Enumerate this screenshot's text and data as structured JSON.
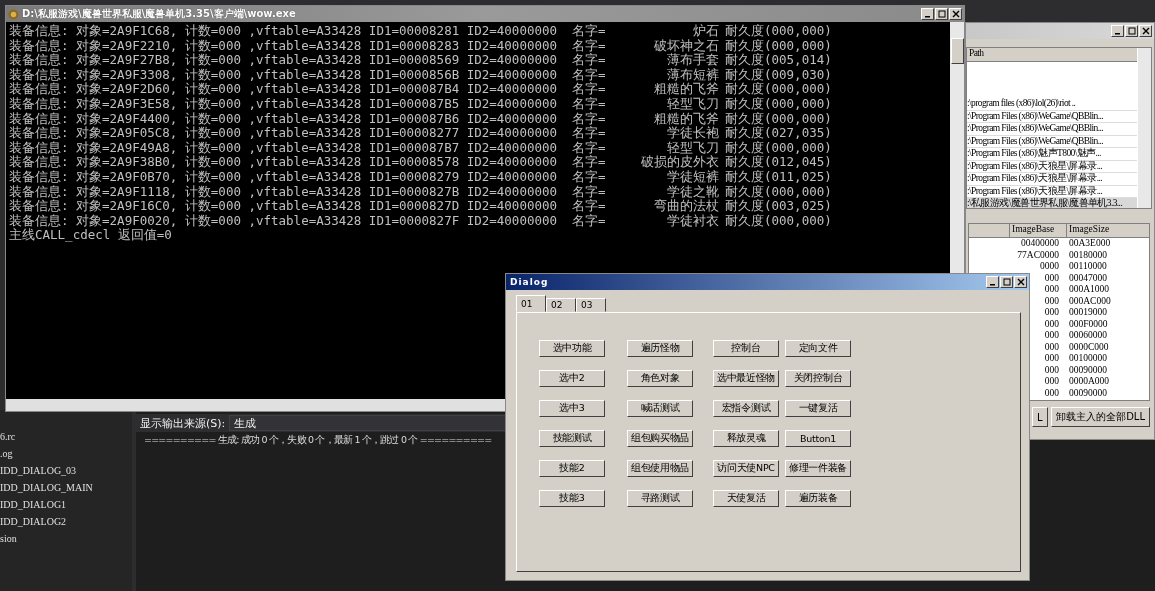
{
  "console": {
    "title": "D:\\私服游戏\\魔兽世界私服\\魔兽单机3.35\\客户端\\wow.exe",
    "lines": [
      {
        "text": "装备信息: 对象=2A9F1C68, 计数=000 ,vftable=A33428 ID1=00008281 ID2=40000000  名字=",
        "name": "炉石",
        "durability": "耐久度(000,000)"
      },
      {
        "text": "装备信息: 对象=2A9F2210, 计数=000 ,vftable=A33428 ID1=00008283 ID2=40000000  名字=",
        "name": "破坏神之石",
        "durability": "耐久度(000,000)"
      },
      {
        "text": "装备信息: 对象=2A9F27B8, 计数=000 ,vftable=A33428 ID1=00008569 ID2=40000000  名字=",
        "name": "薄布手套",
        "durability": "耐久度(005,014)"
      },
      {
        "text": "装备信息: 对象=2A9F3308, 计数=000 ,vftable=A33428 ID1=0000856B ID2=40000000  名字=",
        "name": "薄布短裤",
        "durability": "耐久度(009,030)"
      },
      {
        "text": "装备信息: 对象=2A9F2D60, 计数=000 ,vftable=A33428 ID1=000087B4 ID2=40000000  名字=",
        "name": "粗糙的飞斧",
        "durability": "耐久度(000,000)"
      },
      {
        "text": "装备信息: 对象=2A9F3E58, 计数=000 ,vftable=A33428 ID1=000087B5 ID2=40000000  名字=",
        "name": "轻型飞刀",
        "durability": "耐久度(000,000)"
      },
      {
        "text": "装备信息: 对象=2A9F4400, 计数=000 ,vftable=A33428 ID1=000087B6 ID2=40000000  名字=",
        "name": "粗糙的飞斧",
        "durability": "耐久度(000,000)"
      },
      {
        "text": "装备信息: 对象=2A9F05C8, 计数=000 ,vftable=A33428 ID1=00008277 ID2=40000000  名字=",
        "name": "学徒长袍",
        "durability": "耐久度(027,035)"
      },
      {
        "text": "装备信息: 对象=2A9F49A8, 计数=000 ,vftable=A33428 ID1=000087B7 ID2=40000000  名字=",
        "name": "轻型飞刀",
        "durability": "耐久度(000,000)"
      },
      {
        "text": "装备信息: 对象=2A9F38B0, 计数=000 ,vftable=A33428 ID1=00008578 ID2=40000000  名字=",
        "name": "破损的皮外衣",
        "durability": "耐久度(012,045)"
      },
      {
        "text": "装备信息: 对象=2A9F0B70, 计数=000 ,vftable=A33428 ID1=00008279 ID2=40000000  名字=",
        "name": "学徒短裤",
        "durability": "耐久度(011,025)"
      },
      {
        "text": "装备信息: 对象=2A9F1118, 计数=000 ,vftable=A33428 ID1=0000827B ID2=40000000  名字=",
        "name": "学徒之靴",
        "durability": "耐久度(000,000)"
      },
      {
        "text": "装备信息: 对象=2A9F16C0, 计数=000 ,vftable=A33428 ID1=0000827D ID2=40000000  名字=",
        "name": "弯曲的法杖",
        "durability": "耐久度(003,025)"
      },
      {
        "text": "装备信息: 对象=2A9F0020, 计数=000 ,vftable=A33428 ID1=0000827F ID2=40000000  名字=",
        "name": "学徒衬衣",
        "durability": "耐久度(000,000)"
      }
    ],
    "result": "主线CALL_cdecl 返回值=0"
  },
  "injector": {
    "path_header": "Path",
    "paths": [
      {
        "text": ":\\program files (x86)\\lol(26)\\riot ..",
        "selected": false
      },
      {
        "text": ":\\Program Files (x86)\\WeGame\\QBBlin...",
        "selected": false
      },
      {
        "text": ":\\Program Files (x86)\\WeGame\\QBBlin...",
        "selected": false
      },
      {
        "text": ":\\Program Files (x86)\\WeGame\\QBBlin...",
        "selected": false
      },
      {
        "text": ":\\Program Files (x86)\\魅声T800\\魅声...",
        "selected": false
      },
      {
        "text": ":\\Program Files (x86)\\天狼星\\屏幕录...",
        "selected": false
      },
      {
        "text": ":\\Program Files (x86)\\天狼星\\屏幕录...",
        "selected": false
      },
      {
        "text": ":\\Program Files (x86)\\天狼星\\屏幕录...",
        "selected": false
      },
      {
        "text": ":\\私服游戏\\魔兽世界私服\\魔兽单机3.3...",
        "selected": true
      }
    ],
    "module_columns": [
      "ImageBase",
      "ImageSize"
    ],
    "modules": [
      {
        "base": "00400000",
        "size": "00A3E000"
      },
      {
        "base": "77AC0000",
        "size": "00180000"
      },
      {
        "base": "0000",
        "size": "00110000"
      },
      {
        "base": "000",
        "size": "00047000"
      },
      {
        "base": "000",
        "size": "000A1000"
      },
      {
        "base": "000",
        "size": "000AC000"
      },
      {
        "base": "000",
        "size": "00019000"
      },
      {
        "base": "000",
        "size": "000F0000"
      },
      {
        "base": "000",
        "size": "00060000"
      },
      {
        "base": "000",
        "size": "0000C000"
      },
      {
        "base": "000",
        "size": "00100000"
      },
      {
        "base": "000",
        "size": "00090000"
      },
      {
        "base": "000",
        "size": "0000A000"
      },
      {
        "base": "000",
        "size": "00090000"
      }
    ],
    "buttons": [
      "L",
      "卸载主入的全部DLL"
    ]
  },
  "dialog": {
    "title": "Dialog",
    "tabs": [
      {
        "label": "01",
        "selected": true
      },
      {
        "label": "02",
        "selected": false
      },
      {
        "label": "03",
        "selected": false
      }
    ],
    "buttons": [
      "选中功能",
      "遍历怪物",
      "控制台",
      "定向文件",
      "选中2",
      "角色对象",
      "选中最近怪物",
      "关闭控制台",
      "选中3",
      "喊话测试",
      "宏指令测试",
      "一键复活",
      "技能测试",
      "组包购买物品",
      "释放灵魂",
      "Button1",
      "技能2",
      "组包使用物品",
      "访问天使NPC",
      "修理一件装备",
      "技能3",
      "寻路测试",
      "天使复活",
      "遍历装备"
    ]
  },
  "solution_tree": [
    "6.rc",
    ".og",
    "IDD_DIALOG_03",
    "IDD_DIALOG_MAIN",
    "IDD_DIALOG1",
    "IDD_DIALOG2",
    "sion"
  ],
  "output": {
    "source_label": "显示输出来源(S):",
    "source": "生成",
    "text": "========== 生成: 成功 0 个，失败 0 个，最新 1 个，跳过 0 个 =========="
  }
}
